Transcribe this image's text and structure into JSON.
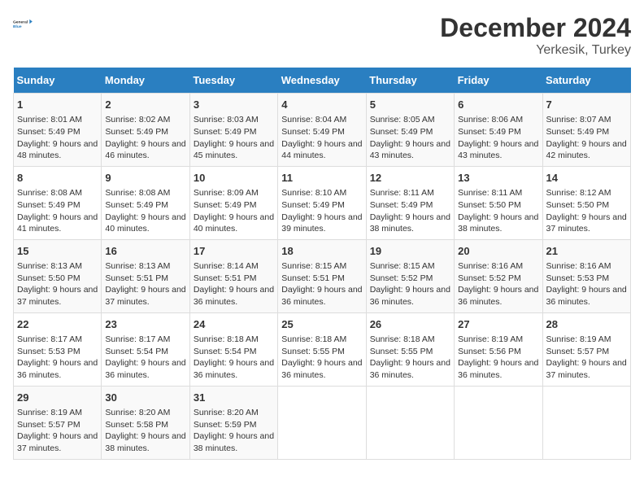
{
  "header": {
    "logo_line1": "General",
    "logo_line2": "Blue",
    "main_title": "December 2024",
    "subtitle": "Yerkesik, Turkey"
  },
  "days_of_week": [
    "Sunday",
    "Monday",
    "Tuesday",
    "Wednesday",
    "Thursday",
    "Friday",
    "Saturday"
  ],
  "weeks": [
    [
      {
        "day": "1",
        "sunrise": "Sunrise: 8:01 AM",
        "sunset": "Sunset: 5:49 PM",
        "daylight": "Daylight: 9 hours and 48 minutes."
      },
      {
        "day": "2",
        "sunrise": "Sunrise: 8:02 AM",
        "sunset": "Sunset: 5:49 PM",
        "daylight": "Daylight: 9 hours and 46 minutes."
      },
      {
        "day": "3",
        "sunrise": "Sunrise: 8:03 AM",
        "sunset": "Sunset: 5:49 PM",
        "daylight": "Daylight: 9 hours and 45 minutes."
      },
      {
        "day": "4",
        "sunrise": "Sunrise: 8:04 AM",
        "sunset": "Sunset: 5:49 PM",
        "daylight": "Daylight: 9 hours and 44 minutes."
      },
      {
        "day": "5",
        "sunrise": "Sunrise: 8:05 AM",
        "sunset": "Sunset: 5:49 PM",
        "daylight": "Daylight: 9 hours and 43 minutes."
      },
      {
        "day": "6",
        "sunrise": "Sunrise: 8:06 AM",
        "sunset": "Sunset: 5:49 PM",
        "daylight": "Daylight: 9 hours and 43 minutes."
      },
      {
        "day": "7",
        "sunrise": "Sunrise: 8:07 AM",
        "sunset": "Sunset: 5:49 PM",
        "daylight": "Daylight: 9 hours and 42 minutes."
      }
    ],
    [
      {
        "day": "8",
        "sunrise": "Sunrise: 8:08 AM",
        "sunset": "Sunset: 5:49 PM",
        "daylight": "Daylight: 9 hours and 41 minutes."
      },
      {
        "day": "9",
        "sunrise": "Sunrise: 8:08 AM",
        "sunset": "Sunset: 5:49 PM",
        "daylight": "Daylight: 9 hours and 40 minutes."
      },
      {
        "day": "10",
        "sunrise": "Sunrise: 8:09 AM",
        "sunset": "Sunset: 5:49 PM",
        "daylight": "Daylight: 9 hours and 40 minutes."
      },
      {
        "day": "11",
        "sunrise": "Sunrise: 8:10 AM",
        "sunset": "Sunset: 5:49 PM",
        "daylight": "Daylight: 9 hours and 39 minutes."
      },
      {
        "day": "12",
        "sunrise": "Sunrise: 8:11 AM",
        "sunset": "Sunset: 5:49 PM",
        "daylight": "Daylight: 9 hours and 38 minutes."
      },
      {
        "day": "13",
        "sunrise": "Sunrise: 8:11 AM",
        "sunset": "Sunset: 5:50 PM",
        "daylight": "Daylight: 9 hours and 38 minutes."
      },
      {
        "day": "14",
        "sunrise": "Sunrise: 8:12 AM",
        "sunset": "Sunset: 5:50 PM",
        "daylight": "Daylight: 9 hours and 37 minutes."
      }
    ],
    [
      {
        "day": "15",
        "sunrise": "Sunrise: 8:13 AM",
        "sunset": "Sunset: 5:50 PM",
        "daylight": "Daylight: 9 hours and 37 minutes."
      },
      {
        "day": "16",
        "sunrise": "Sunrise: 8:13 AM",
        "sunset": "Sunset: 5:51 PM",
        "daylight": "Daylight: 9 hours and 37 minutes."
      },
      {
        "day": "17",
        "sunrise": "Sunrise: 8:14 AM",
        "sunset": "Sunset: 5:51 PM",
        "daylight": "Daylight: 9 hours and 36 minutes."
      },
      {
        "day": "18",
        "sunrise": "Sunrise: 8:15 AM",
        "sunset": "Sunset: 5:51 PM",
        "daylight": "Daylight: 9 hours and 36 minutes."
      },
      {
        "day": "19",
        "sunrise": "Sunrise: 8:15 AM",
        "sunset": "Sunset: 5:52 PM",
        "daylight": "Daylight: 9 hours and 36 minutes."
      },
      {
        "day": "20",
        "sunrise": "Sunrise: 8:16 AM",
        "sunset": "Sunset: 5:52 PM",
        "daylight": "Daylight: 9 hours and 36 minutes."
      },
      {
        "day": "21",
        "sunrise": "Sunrise: 8:16 AM",
        "sunset": "Sunset: 5:53 PM",
        "daylight": "Daylight: 9 hours and 36 minutes."
      }
    ],
    [
      {
        "day": "22",
        "sunrise": "Sunrise: 8:17 AM",
        "sunset": "Sunset: 5:53 PM",
        "daylight": "Daylight: 9 hours and 36 minutes."
      },
      {
        "day": "23",
        "sunrise": "Sunrise: 8:17 AM",
        "sunset": "Sunset: 5:54 PM",
        "daylight": "Daylight: 9 hours and 36 minutes."
      },
      {
        "day": "24",
        "sunrise": "Sunrise: 8:18 AM",
        "sunset": "Sunset: 5:54 PM",
        "daylight": "Daylight: 9 hours and 36 minutes."
      },
      {
        "day": "25",
        "sunrise": "Sunrise: 8:18 AM",
        "sunset": "Sunset: 5:55 PM",
        "daylight": "Daylight: 9 hours and 36 minutes."
      },
      {
        "day": "26",
        "sunrise": "Sunrise: 8:18 AM",
        "sunset": "Sunset: 5:55 PM",
        "daylight": "Daylight: 9 hours and 36 minutes."
      },
      {
        "day": "27",
        "sunrise": "Sunrise: 8:19 AM",
        "sunset": "Sunset: 5:56 PM",
        "daylight": "Daylight: 9 hours and 36 minutes."
      },
      {
        "day": "28",
        "sunrise": "Sunrise: 8:19 AM",
        "sunset": "Sunset: 5:57 PM",
        "daylight": "Daylight: 9 hours and 37 minutes."
      }
    ],
    [
      {
        "day": "29",
        "sunrise": "Sunrise: 8:19 AM",
        "sunset": "Sunset: 5:57 PM",
        "daylight": "Daylight: 9 hours and 37 minutes."
      },
      {
        "day": "30",
        "sunrise": "Sunrise: 8:20 AM",
        "sunset": "Sunset: 5:58 PM",
        "daylight": "Daylight: 9 hours and 38 minutes."
      },
      {
        "day": "31",
        "sunrise": "Sunrise: 8:20 AM",
        "sunset": "Sunset: 5:59 PM",
        "daylight": "Daylight: 9 hours and 38 minutes."
      },
      null,
      null,
      null,
      null
    ]
  ]
}
